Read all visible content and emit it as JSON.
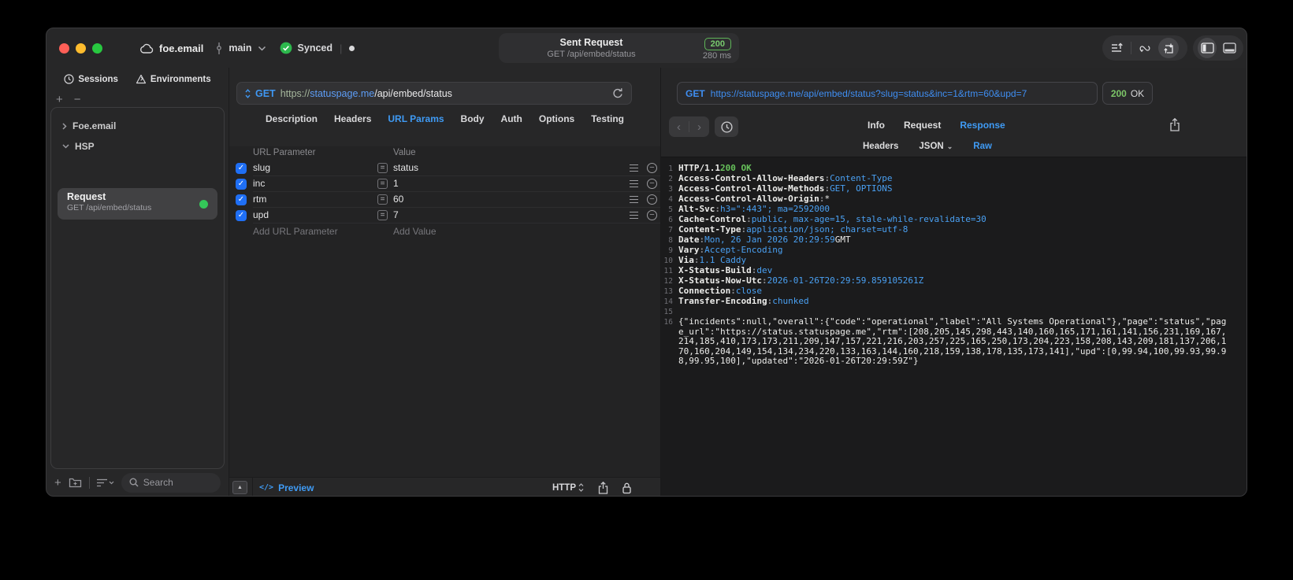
{
  "titlebar": {
    "project": "foe.email",
    "branch": "main",
    "sync_status": "Synced",
    "request_capsule": {
      "title": "Sent Request",
      "subtitle": "GET /api/embed/status",
      "status_code": "200",
      "duration": "280 ms"
    }
  },
  "sidebar": {
    "tabs": [
      {
        "label": "Sessions",
        "icon": "history-icon"
      },
      {
        "label": "Environments",
        "icon": "environments-icon"
      }
    ],
    "tree": [
      {
        "label": "Foe.email",
        "state": "collapsed"
      },
      {
        "label": "HSP",
        "state": "expanded"
      }
    ],
    "request_item": {
      "title": "Request",
      "subtitle": "GET /api/embed/status",
      "status_dot_color": "#34c759"
    },
    "search": {
      "placeholder": "Search"
    }
  },
  "request_editor": {
    "method": "GET",
    "url": {
      "scheme": "https://",
      "host": "statuspage.me",
      "path": "/api/embed/status"
    },
    "tabs": [
      "Description",
      "Headers",
      "URL Params",
      "Body",
      "Auth",
      "Options",
      "Testing"
    ],
    "active_tab": "URL Params",
    "params_table": {
      "columns": {
        "name": "URL Parameter",
        "value": "Value"
      },
      "rows": [
        {
          "name": "slug",
          "value": "status",
          "enabled": true
        },
        {
          "name": "inc",
          "value": "1",
          "enabled": true
        },
        {
          "name": "rtm",
          "value": "60",
          "enabled": true
        },
        {
          "name": "upd",
          "value": "7",
          "enabled": true
        }
      ],
      "add_row": {
        "name_placeholder": "Add URL Parameter",
        "value_placeholder": "Add Value"
      }
    },
    "footer": {
      "preview_label": "Preview",
      "code_glyph": "</>",
      "protocol_label": "HTTP"
    }
  },
  "response_viewer": {
    "request_summary": {
      "method": "GET",
      "url": "https://statuspage.me/api/embed/status?slug=status&inc=1&rtm=60&upd=7"
    },
    "status": {
      "code": "200",
      "text": "OK"
    },
    "tabs": [
      "Info",
      "Request",
      "Response"
    ],
    "active_tab": "Response",
    "subtabs": [
      "Headers",
      "JSON",
      "Raw"
    ],
    "active_subtab": "Raw",
    "lines": [
      {
        "n": 1,
        "kind": "status",
        "name": "HTTP/1.1",
        "value": "200 OK"
      },
      {
        "n": 2,
        "kind": "header",
        "name": "Access-Control-Allow-Headers",
        "value": "Content-Type"
      },
      {
        "n": 3,
        "kind": "header",
        "name": "Access-Control-Allow-Methods",
        "value": "GET, OPTIONS"
      },
      {
        "n": 4,
        "kind": "header",
        "name": "Access-Control-Allow-Origin",
        "value": "",
        "plain": "*"
      },
      {
        "n": 5,
        "kind": "header",
        "name": "Alt-Svc",
        "value": "h3=\":443\"; ma=2592000"
      },
      {
        "n": 6,
        "kind": "header",
        "name": "Cache-Control",
        "value": "public, max-age=15, stale-while-revalidate=30"
      },
      {
        "n": 7,
        "kind": "header",
        "name": "Content-Type",
        "value": "application/json; charset=utf-8"
      },
      {
        "n": 8,
        "kind": "header",
        "name": "Date",
        "value": "Mon, 26 Jan 2026 20:29:59",
        "plain": " GMT"
      },
      {
        "n": 9,
        "kind": "header",
        "name": "Vary",
        "value": "Accept-Encoding"
      },
      {
        "n": 10,
        "kind": "header",
        "name": "Via",
        "value": "1.1 Caddy"
      },
      {
        "n": 11,
        "kind": "header",
        "name": "X-Status-Build",
        "value": "dev"
      },
      {
        "n": 12,
        "kind": "header",
        "name": "X-Status-Now-Utc",
        "value": "2026-01-26T20:29:59.859105261Z"
      },
      {
        "n": 13,
        "kind": "header",
        "name": "Connection",
        "value": "close"
      },
      {
        "n": 14,
        "kind": "header",
        "name": "Transfer-Encoding",
        "value": "chunked"
      },
      {
        "n": 15,
        "kind": "blank"
      },
      {
        "n": 16,
        "kind": "body",
        "text": "{\"incidents\":null,\"overall\":{\"code\":\"operational\",\"label\":\"All Systems Operational\"},\"page\":\"status\",\"page_url\":\"https://status.statuspage.me\",\"rtm\":[208,205,145,298,443,140,160,165,171,161,141,156,231,169,167,214,185,410,173,173,211,209,147,157,221,216,203,257,225,165,250,173,204,223,158,208,143,209,181,137,206,170,160,204,149,154,134,234,220,133,163,144,160,218,159,138,178,135,173,141],\"upd\":[0,99.94,100,99.93,99.98,99.95,100],\"updated\":\"2026-01-26T20:29:59Z\"}"
      }
    ]
  },
  "colors": {
    "accent_blue": "#3f9bf5",
    "status_green": "#67c25b",
    "checkbox_blue": "#1f6ff5",
    "request_dot_green": "#34c759"
  }
}
